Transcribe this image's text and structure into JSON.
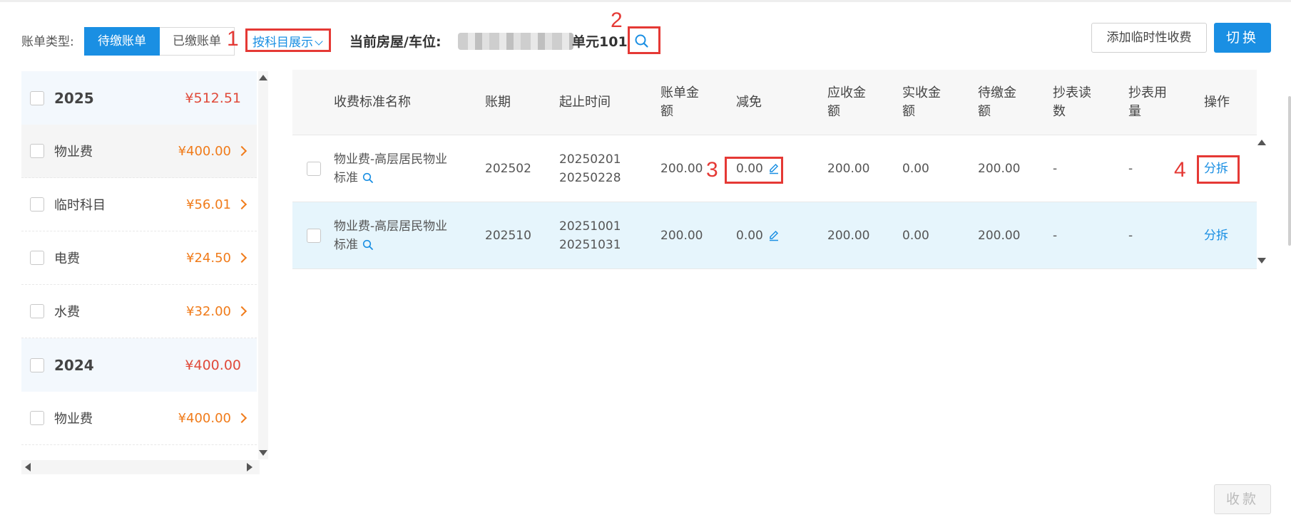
{
  "header": {
    "bill_type_label": "账单类型:",
    "tabs": [
      {
        "label": "待缴账单",
        "active": true
      },
      {
        "label": "已缴账单",
        "active": false
      }
    ],
    "view_mode": "按科目展示",
    "room_label": "当前房屋/车位:",
    "room_value": "单元101",
    "add_temp_fee_label": "添加临时性收费",
    "switch_label": "切换"
  },
  "annotations": [
    "1",
    "2",
    "3",
    "4"
  ],
  "left_list": [
    {
      "name": "2025",
      "amount": "¥512.51",
      "type": "year"
    },
    {
      "name": "物业费",
      "amount": "¥400.00",
      "type": "item",
      "selected": true
    },
    {
      "name": "临时科目",
      "amount": "¥56.01",
      "type": "item"
    },
    {
      "name": "电费",
      "amount": "¥24.50",
      "type": "item"
    },
    {
      "name": "水费",
      "amount": "¥32.00",
      "type": "item"
    },
    {
      "name": "2024",
      "amount": "¥400.00",
      "type": "year"
    },
    {
      "name": "物业费",
      "amount": "¥400.00",
      "type": "item"
    }
  ],
  "table": {
    "headers": [
      "收费标准名称",
      "账期",
      "起止时间",
      "账单金额",
      "减免",
      "应收金额",
      "实收金额",
      "待缴金额",
      "抄表读数",
      "抄表用量",
      "操作"
    ],
    "rows": [
      {
        "name_line1": "物业费-高层居民物业",
        "name_line2": "标准",
        "period": "202502",
        "start": "20250201",
        "end": "20250228",
        "bill_amount": "200.00",
        "discount": "0.00",
        "receivable": "200.00",
        "received": "0.00",
        "pending": "200.00",
        "reading": "-",
        "usage": "-",
        "action": "分拆"
      },
      {
        "name_line1": "物业费-高层居民物业",
        "name_line2": "标准",
        "period": "202510",
        "start": "20251001",
        "end": "20251031",
        "bill_amount": "200.00",
        "discount": "0.00",
        "receivable": "200.00",
        "received": "0.00",
        "pending": "200.00",
        "reading": "-",
        "usage": "-",
        "action": "分拆"
      }
    ]
  },
  "footer": {
    "collect_label": "收款"
  },
  "colors": {
    "primary": "#1a8fe3",
    "amount_orange": "#f07b1a",
    "amount_red": "#e04a3a",
    "annotation_red": "#e53935",
    "row_highlight": "#e6f5fc"
  }
}
